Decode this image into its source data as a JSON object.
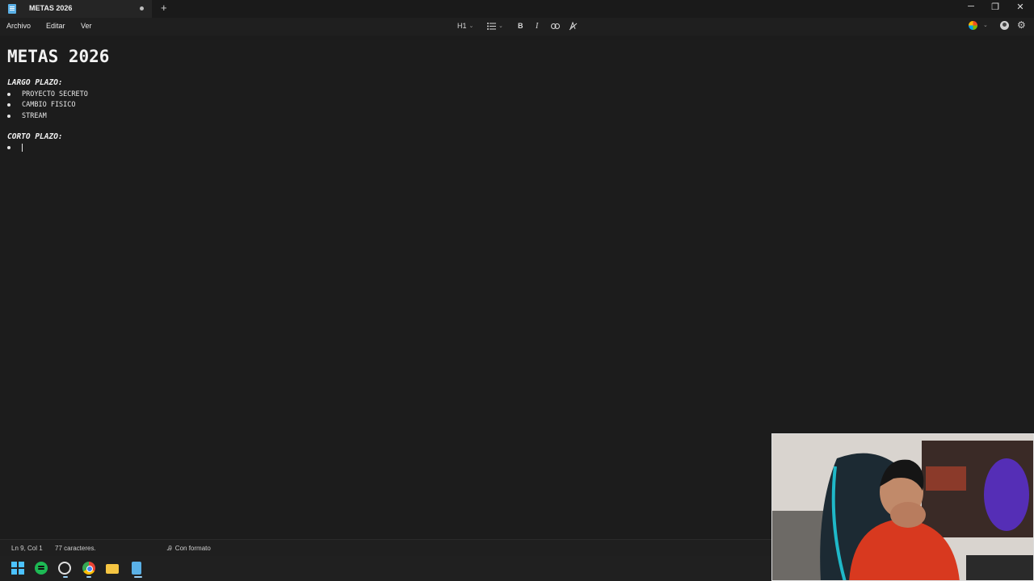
{
  "window": {
    "tab_title": "METAS 2026",
    "new_tab": "+",
    "controls": {
      "minimize": "─",
      "restore": "❐",
      "close": "✕"
    }
  },
  "menu": {
    "file": "Archivo",
    "edit": "Editar",
    "view": "Ver"
  },
  "toolbar": {
    "heading": "H1",
    "list_icon": "list-icon",
    "bold": "B",
    "italic": "I",
    "link_icon": "link-icon",
    "clear_format_icon": "clear-format-icon",
    "chevron": "⌄"
  },
  "document": {
    "title": "METAS 2026",
    "sections": [
      {
        "heading": "LARGO PLAZO:",
        "items": [
          "PROYECTO SECRETO",
          "CAMBIO FISICO",
          "STREAM"
        ]
      },
      {
        "heading": "CORTO PLAZO:",
        "items": [
          ""
        ]
      }
    ]
  },
  "status": {
    "position": "Ln 9, Col 1",
    "characters": "77 caracteres.",
    "format": "Con formato"
  },
  "taskbar": {
    "apps": [
      "windows-start-icon",
      "spotify-icon",
      "obs-icon",
      "chrome-icon",
      "file-explorer-icon",
      "notepad-icon"
    ]
  },
  "colors": {
    "background": "#1c1c1c",
    "text": "#e6e6e6",
    "accent": "#5ab0e6"
  }
}
